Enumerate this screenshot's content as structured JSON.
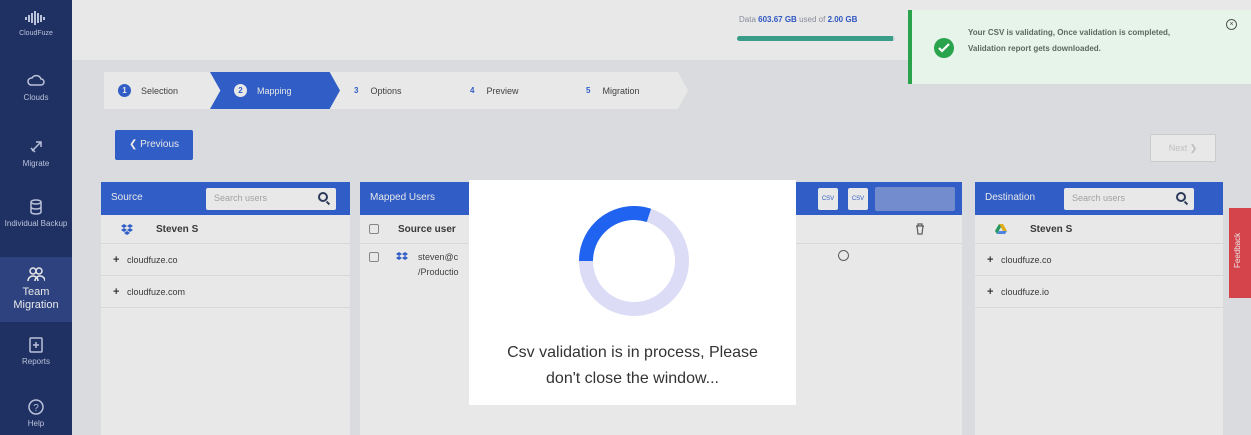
{
  "sidebar": {
    "logo": "CloudFuze",
    "items": [
      {
        "label": "Clouds",
        "icon": "cloud-icon"
      },
      {
        "label": "Migrate",
        "icon": "rocket-icon"
      },
      {
        "label": "Individual Backup",
        "icon": "database-icon"
      },
      {
        "label": "Team Migration",
        "icon": "users-icon"
      },
      {
        "label": "Reports",
        "icon": "report-icon"
      },
      {
        "label": "Help",
        "icon": "help-icon"
      }
    ]
  },
  "topbar": {
    "data_prefix": "Data",
    "data_used": "603.67 GB",
    "data_mid": "used of",
    "data_total": "2.00 GB",
    "usage_fraction": 0.99
  },
  "toast": {
    "message": "Your CSV is validating, Once validation is completed, Validation report gets downloaded.",
    "color": "#2aa44c"
  },
  "steps": [
    {
      "num": "1",
      "label": "Selection"
    },
    {
      "num": "2",
      "label": "Mapping"
    },
    {
      "num": "3",
      "label": "Options"
    },
    {
      "num": "4",
      "label": "Preview"
    },
    {
      "num": "5",
      "label": "Migration"
    }
  ],
  "buttons": {
    "previous": "Previous",
    "next": "Next"
  },
  "source": {
    "title": "Source",
    "search_placeholder": "Search users",
    "user": "Steven S",
    "domains": [
      "cloudfuze.co",
      "cloudfuze.com"
    ]
  },
  "mapped": {
    "title": "Mapped Users",
    "column_source": "Source user",
    "row_user": "steven@c",
    "row_path": "/Productio",
    "csv_labels": [
      "CSV",
      "CSV"
    ]
  },
  "destination": {
    "title": "Destination",
    "search_placeholder": "Search users",
    "user": "Steven S",
    "domains": [
      "cloudfuze.co",
      "cloudfuze.io"
    ]
  },
  "feedback": "Feedback",
  "modal": {
    "line1": "Csv validation is in process, Please",
    "line2": "don't close the window...",
    "spinner_fraction": 0.3
  },
  "colors": {
    "primary": "#1f56d6",
    "sidebar": "#0a1f5c",
    "feedback": "#e8383f"
  }
}
